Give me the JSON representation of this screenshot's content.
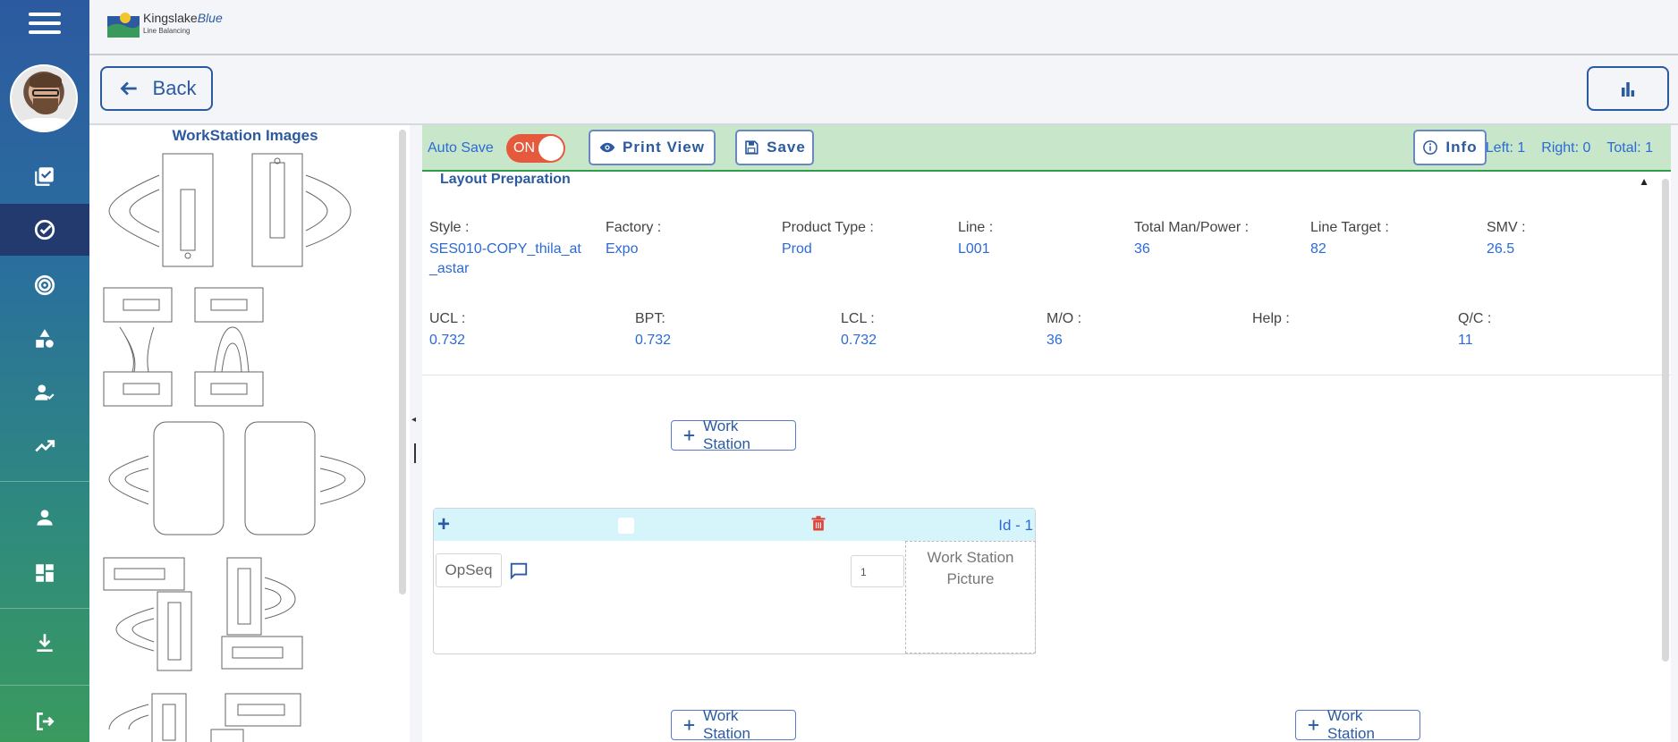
{
  "app": {
    "logo_name": "Kingslake",
    "logo_name_accent": "Blue",
    "logo_subtitle": "Line Balancing"
  },
  "colors": {
    "brand": "#2c5aa0",
    "toggle_on": "#e55a3d",
    "toolbar_bg": "#c8e6c9",
    "ws_header_bg": "#d6f5fa",
    "link_blue": "#2c6ad6"
  },
  "sidebar": {
    "items": [
      {
        "icon": "checklist-icon",
        "active": false
      },
      {
        "icon": "check-circle-icon",
        "active": true
      },
      {
        "icon": "target-icon",
        "active": false
      },
      {
        "icon": "shapes-icon",
        "active": false
      },
      {
        "icon": "user-check-icon",
        "active": false
      },
      {
        "icon": "trending-up-icon",
        "active": false
      },
      {
        "icon": "person-icon",
        "active": false
      },
      {
        "icon": "dashboard-icon",
        "active": false
      },
      {
        "icon": "download-icon",
        "active": false
      },
      {
        "icon": "logout-icon",
        "active": false
      }
    ]
  },
  "nav": {
    "back_label": "Back"
  },
  "left_panel": {
    "title": "WorkStation Images"
  },
  "toolbar": {
    "autosave_label": "Auto Save",
    "toggle_state": "ON",
    "print_label": "Print View",
    "save_label": "Save",
    "info_label": "Info",
    "left_text": "Left: 1",
    "right_text": "Right: 0",
    "total_text": "Total: 1"
  },
  "layout_prep": {
    "heading": "Layout Preparation",
    "row1": [
      {
        "label": "Style :",
        "value": "SES010-COPY_thila_at",
        "value2": "_astar"
      },
      {
        "label": "Factory :",
        "value": "Expo"
      },
      {
        "label": "Product Type :",
        "value": "Prod"
      },
      {
        "label": "Line :",
        "value": "L001"
      },
      {
        "label": "Total Man/Power :",
        "value": "36"
      },
      {
        "label": "Line Target :",
        "value": "82"
      },
      {
        "label": "SMV :",
        "value": "26.5"
      }
    ],
    "row2": [
      {
        "label": "UCL :",
        "value": "0.732"
      },
      {
        "label": "BPT:",
        "value": "0.732"
      },
      {
        "label": "LCL :",
        "value": "0.732"
      },
      {
        "label": "M/O :",
        "value": "36"
      },
      {
        "label": "Help :",
        "value": ""
      },
      {
        "label": "Q/C :",
        "value": "11"
      }
    ]
  },
  "workstation": {
    "add_label": "Work Station",
    "id_label": "Id - 1",
    "opseq_placeholder": "OpSeq",
    "qty_value": "1",
    "picture_line1": "Work Station",
    "picture_line2": "Picture"
  }
}
